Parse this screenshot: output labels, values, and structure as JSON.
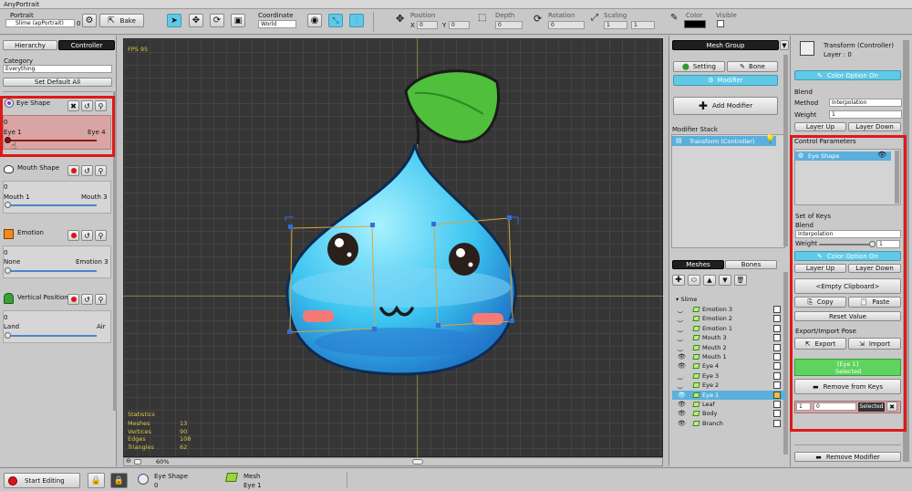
{
  "app_title": "AnyPortrait",
  "toolbar": {
    "portrait_label": "Portrait",
    "portrait_value": "Slime (apPortrait)",
    "portrait_count": "0",
    "bake_label": "Bake",
    "coordinate_label": "Coordinate",
    "coordinate_value": "World",
    "position_label": "Position",
    "x_label": "X",
    "x_value": "0",
    "y_label": "Y",
    "y_value": "0",
    "depth_label": "Depth",
    "depth_value": "0",
    "rotation_label": "Rotation",
    "rotation_value": "0",
    "scaling_label": "Scaling",
    "scale_x": "1",
    "scale_y": "1",
    "color_label": "Color",
    "visible_label": "Visible"
  },
  "left": {
    "tab_hierarchy": "Hierarchy",
    "tab_controller": "Controller",
    "category_label": "Category",
    "category_value": "Everything",
    "set_default": "Set Default All",
    "params": [
      {
        "name": "Eye Shape",
        "value": "0",
        "min": "Eye 1",
        "max": "Eye 4",
        "level": 0
      },
      {
        "name": "Mouth Shape",
        "value": "0",
        "min": "Mouth 1",
        "max": "Mouth 3",
        "level": 0
      },
      {
        "name": "Emotion",
        "value": "0",
        "min": "None",
        "max": "Emotion 3",
        "level": 0
      },
      {
        "name": "Vertical Position",
        "value": "0",
        "min": "Land",
        "max": "Air",
        "level": 0
      }
    ]
  },
  "viewport": {
    "fps": "FPS 95",
    "stats_title": "Statistics",
    "stats": [
      {
        "label": "Meshes",
        "value": "13"
      },
      {
        "label": "Vertices",
        "value": "90"
      },
      {
        "label": "Edges",
        "value": "108"
      },
      {
        "label": "Triangles",
        "value": "62"
      }
    ],
    "zoom": "60%"
  },
  "mid": {
    "mesh_group": "Mesh Group",
    "setting": "Setting",
    "bone": "Bone",
    "modifier": "Modifier",
    "add_modifier": "Add Modifier",
    "modifier_stack": "Modifier Stack",
    "stack_item": "Transform (Controller)",
    "tab_meshes": "Meshes",
    "tab_bones": "Bones",
    "root": "Slime",
    "items": [
      "Emotion 3",
      "Emotion 2",
      "Emotion 1",
      "Mouth 3",
      "Mouth 2",
      "Mouth 1",
      "Eye 4",
      "Eye 3",
      "Eye 2",
      "Eye 1",
      "Leaf",
      "Body",
      "Branch"
    ]
  },
  "right": {
    "title": "Transform (Controller)",
    "layer": "Layer : 0",
    "color_option": "Color Option On",
    "blend": "Blend",
    "method_label": "Method",
    "method_value": "Interpolation",
    "weight_label": "Weight",
    "weight_value": "1",
    "layer_up": "Layer Up",
    "layer_down": "Layer Down",
    "control_params": "Control Parameters",
    "cp_item": "Eye Shape",
    "set_of_keys": "Set of Keys",
    "blend2": "Blend",
    "interp2": "Interpolation",
    "weight2_label": "Weight",
    "weight2_value": "1",
    "color_option2": "Color Option On",
    "layer_up2": "Layer Up",
    "layer_down2": "Layer Down",
    "clipboard": "<Empty Clipboard>",
    "copy": "Copy",
    "paste": "Paste",
    "reset": "Reset Value",
    "export_import": "Export/Import Pose",
    "export": "Export",
    "import": "Import",
    "selected_key": "[Eye 1]",
    "selected_word": "Selected",
    "remove_keys": "Remove from Keys",
    "key_index": "1",
    "key_value": "0",
    "key_selected": "Selected",
    "remove_modifier": "Remove Modifier"
  },
  "bottom": {
    "start_editing": "Start Editing",
    "param_name": "Eye Shape",
    "param_value": "0",
    "mesh_label": "Mesh",
    "mesh_value": "Eye 1"
  }
}
